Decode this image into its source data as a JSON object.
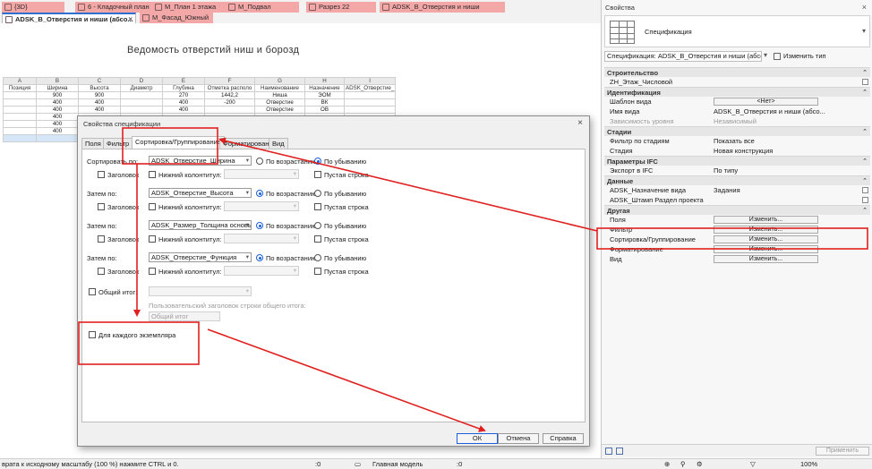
{
  "tabs": [
    {
      "label": "{3D}"
    },
    {
      "label": "6 - Кладочный план"
    },
    {
      "label": "М_План 1 этажа"
    },
    {
      "label": "М_Подвал"
    },
    {
      "label": "Разрез 22"
    },
    {
      "label": "ADSK_В_Отверстия и ниши"
    },
    {
      "label": "ADSK_В_Отверстия и ниши (абсо..."
    },
    {
      "label": "М_Фасад_Южный"
    }
  ],
  "schedule": {
    "title": "Ведомость отверстий ниш и борозд",
    "letters": [
      "A",
      "B",
      "C",
      "D",
      "E",
      "F",
      "G",
      "H",
      "I"
    ],
    "headers": [
      "Позиция",
      "Ширина",
      "Высота",
      "Диаметр",
      "Глубина",
      "Отметка располо",
      "Наименование",
      "Назначение",
      "ADSK_Отверстие_"
    ],
    "rows": [
      [
        "",
        "900",
        "900",
        "",
        "270",
        "1442,2",
        "Ниша",
        "ЭОМ",
        ""
      ],
      [
        "",
        "400",
        "400",
        "",
        "400",
        "-200",
        "Отверстие",
        "ВК",
        ""
      ],
      [
        "",
        "400",
        "400",
        "",
        "400",
        "",
        "Отверстие",
        "ОВ",
        ""
      ],
      [
        "",
        "400",
        "",
        "",
        "",
        "",
        "",
        "",
        ""
      ],
      [
        "",
        "400",
        "",
        "",
        "",
        "",
        "",
        "",
        ""
      ],
      [
        "",
        "400",
        "",
        "",
        "",
        "",
        "",
        "",
        ""
      ]
    ]
  },
  "properties": {
    "title": "Свойства",
    "type_name": "Спецификация",
    "instance_selector": "Спецификация: ADSK_В_Отверстия и ниши (абсол",
    "edit_type_label": "Изменить тип",
    "sections": [
      {
        "name": "Строительство",
        "rows": [
          {
            "key": "ZH_Этаж_Числовой",
            "value": "",
            "check": true
          }
        ]
      },
      {
        "name": "Идентификация",
        "rows": [
          {
            "key": "Шаблон вида",
            "value": "<Нет>",
            "button": true
          },
          {
            "key": "Имя вида",
            "value": "ADSK_В_Отверстия и ниши (абсо..."
          },
          {
            "key": "Зависимость уровня",
            "value": "Независимый",
            "disabled": true
          }
        ]
      },
      {
        "name": "Стадии",
        "rows": [
          {
            "key": "Фильтр по стадиям",
            "value": "Показать все"
          },
          {
            "key": "Стадия",
            "value": "Новая конструкция"
          }
        ]
      },
      {
        "name": "Параметры IFC",
        "rows": [
          {
            "key": "Экспорт в IFC",
            "value": "По типу"
          }
        ]
      },
      {
        "name": "Данные",
        "rows": [
          {
            "key": "ADSK_Назначение вида",
            "value": "Задания",
            "check": true
          },
          {
            "key": "ADSK_Штамп Раздел проекта",
            "value": "",
            "check": true
          }
        ]
      },
      {
        "name": "Другая",
        "rows": [
          {
            "key": "Поля",
            "value": "Изменить...",
            "button": true
          },
          {
            "key": "Фильтр",
            "value": "Изменить...",
            "button": true
          },
          {
            "key": "Сортировка/Группирование",
            "value": "Изменить...",
            "button": true
          },
          {
            "key": "Форматирование",
            "value": "Изменить...",
            "button": true
          },
          {
            "key": "Вид",
            "value": "Изменить...",
            "button": true
          }
        ]
      }
    ],
    "apply_label": "Применить"
  },
  "dialog": {
    "title": "Свойства спецификации",
    "tabs": [
      "Поля",
      "Фильтр",
      "Сортировка/Группирование",
      "Форматирование",
      "Вид"
    ],
    "sort_rows": [
      {
        "label": "Сортировать по:",
        "field": "ADSK_Отверстие_Ширина",
        "asc_label": "По возрастанию",
        "desc_label": "По убыванию",
        "order": "desc",
        "header_label": "Заголовок",
        "footer_label": "Нижний колонтитул:",
        "blank_label": "Пустая строка"
      },
      {
        "label": "Затем по:",
        "field": "ADSK_Отверстие_Высота",
        "asc_label": "По возрастанию",
        "desc_label": "По убыванию",
        "order": "asc",
        "header_label": "Заголовок",
        "footer_label": "Нижний колонтитул:",
        "blank_label": "Пустая строка"
      },
      {
        "label": "Затем по:",
        "field": "ADSK_Размер_Толщина основы",
        "asc_label": "По возрастанию",
        "desc_label": "По убыванию",
        "order": "asc",
        "header_label": "Заголовок",
        "footer_label": "Нижний колонтитул:",
        "blank_label": "Пустая строка"
      },
      {
        "label": "Затем по:",
        "field": "ADSK_Отверстие_Функция",
        "asc_label": "По возрастанию",
        "desc_label": "По убыванию",
        "order": "asc",
        "header_label": "Заголовок",
        "footer_label": "Нижний колонтитул:",
        "blank_label": "Пустая строка"
      }
    ],
    "grand_total_label": "Общий итог:",
    "custom_header_label": "Пользовательский заголовок строки общего итога:",
    "custom_header_value": "Общий итог",
    "each_instance_label": "Для каждого экземпляра",
    "ok_label": "ОК",
    "cancel_label": "Отмена",
    "help_label": "Справка"
  },
  "status": {
    "hint": "врата к исходному масштабу (100 %) нажмите CTRL и 0.",
    "coord1": ":0",
    "coord2": ":0",
    "model": "Главная модель",
    "zoom": "100%"
  },
  "colors": {
    "annotation": "#e0201f",
    "tab_pink": "#f4a7a7",
    "accent": "#1a5fd8"
  }
}
